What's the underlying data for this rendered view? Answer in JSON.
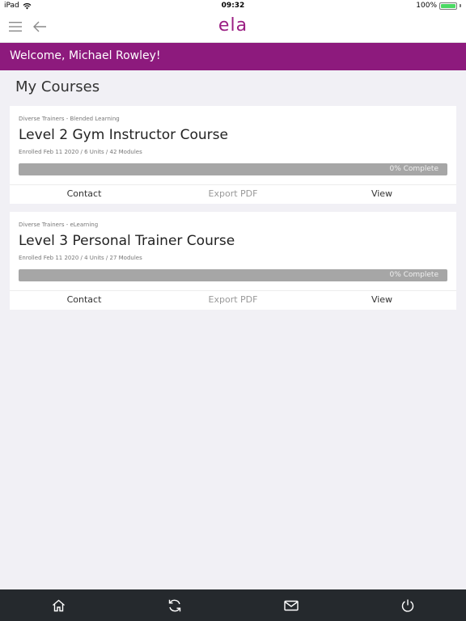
{
  "status_bar": {
    "device": "iPad",
    "time": "09:32",
    "battery": "100%",
    "battery_color": "#4cd964"
  },
  "nav": {
    "logo": "ela",
    "menu_icon": "hamburger-menu-icon",
    "back_icon": "arrow-left-icon"
  },
  "welcome": {
    "text": "Welcome, Michael Rowley!",
    "bg_color": "#8d1a7d"
  },
  "page": {
    "title": "My Courses"
  },
  "courses": [
    {
      "provider": "Diverse Trainers - Blended Learning",
      "title": "Level 2 Gym Instructor Course",
      "meta": "Enrolled Feb 11 2020 / 6 Units / 42 Modules",
      "progress_percent": 0,
      "progress_label": "0% Complete",
      "actions": {
        "contact": "Contact",
        "export": "Export PDF",
        "view": "View"
      }
    },
    {
      "provider": "Diverse Trainers - eLearning",
      "title": "Level 3 Personal Trainer Course",
      "meta": "Enrolled Feb 11 2020 / 4 Units / 27 Modules",
      "progress_percent": 0,
      "progress_label": "0% Complete",
      "actions": {
        "contact": "Contact",
        "export": "Export PDF",
        "view": "View"
      }
    }
  ],
  "tab_bar": {
    "items": [
      "home-icon",
      "refresh-icon",
      "mail-icon",
      "power-icon"
    ],
    "bg_color": "#25292d"
  }
}
